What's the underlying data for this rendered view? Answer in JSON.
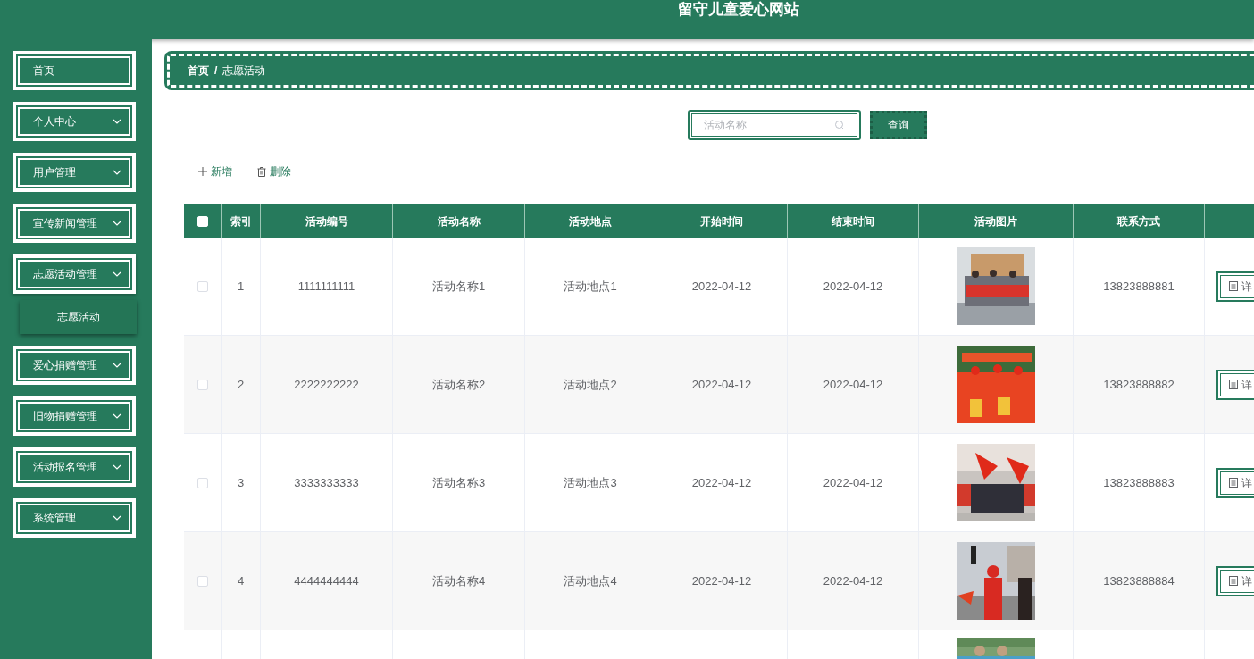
{
  "header": {
    "title": "留守儿童爱心网站"
  },
  "sidebar": {
    "items": [
      {
        "label": "首页",
        "has_children": false,
        "expanded": false
      },
      {
        "label": "个人中心",
        "has_children": true,
        "expanded": false
      },
      {
        "label": "用户管理",
        "has_children": true,
        "expanded": false
      },
      {
        "label": "宣传新闻管理",
        "has_children": true,
        "expanded": false
      },
      {
        "label": "志愿活动管理",
        "has_children": true,
        "expanded": true,
        "children": [
          {
            "label": "志愿活动",
            "selected": true
          }
        ]
      },
      {
        "label": "爱心捐赠管理",
        "has_children": true,
        "expanded": false
      },
      {
        "label": "旧物捐赠管理",
        "has_children": true,
        "expanded": false
      },
      {
        "label": "活动报名管理",
        "has_children": true,
        "expanded": false
      },
      {
        "label": "系统管理",
        "has_children": true,
        "expanded": false
      }
    ]
  },
  "breadcrumb": [
    "首页",
    "志愿活动"
  ],
  "breadcrumb_separator": "/",
  "search": {
    "placeholder": "活动名称",
    "button": "查询"
  },
  "toolbar": {
    "add": "新增",
    "delete": "删除"
  },
  "table": {
    "select_all_checked": false,
    "columns": [
      "索引",
      "活动编号",
      "活动名称",
      "活动地点",
      "开始时间",
      "结束时间",
      "活动图片",
      "联系方式"
    ],
    "rows": [
      {
        "checked": false,
        "index": "1",
        "code": "1111111111",
        "name": "活动名称1",
        "place": "活动地点1",
        "start": "2022-04-12",
        "end": "2022-04-12",
        "phone": "13823888881",
        "action": "详"
      },
      {
        "checked": false,
        "index": "2",
        "code": "2222222222",
        "name": "活动名称2",
        "place": "活动地点2",
        "start": "2022-04-12",
        "end": "2022-04-12",
        "phone": "13823888882",
        "action": "详"
      },
      {
        "checked": false,
        "index": "3",
        "code": "3333333333",
        "name": "活动名称3",
        "place": "活动地点3",
        "start": "2022-04-12",
        "end": "2022-04-12",
        "phone": "13823888883",
        "action": "详"
      },
      {
        "checked": false,
        "index": "4",
        "code": "4444444444",
        "name": "活动名称4",
        "place": "活动地点4",
        "start": "2022-04-12",
        "end": "2022-04-12",
        "phone": "13823888884",
        "action": "详"
      }
    ]
  }
}
